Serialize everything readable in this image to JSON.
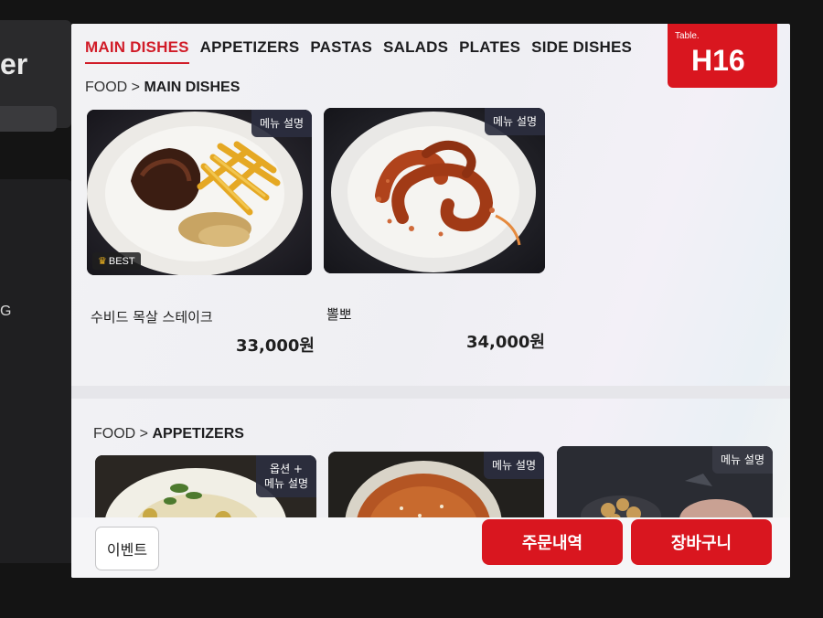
{
  "side": {
    "brand_fragment": "er",
    "nav_fragment": "G"
  },
  "tabs": [
    {
      "label": "MAIN DISHES",
      "active": true
    },
    {
      "label": "APPETIZERS",
      "active": false
    },
    {
      "label": "PASTAS",
      "active": false
    },
    {
      "label": "SALADS",
      "active": false
    },
    {
      "label": "PLATES",
      "active": false
    },
    {
      "label": "SIDE DISHES",
      "active": false
    }
  ],
  "table": {
    "label": "Table.",
    "value": "H16"
  },
  "sections": [
    {
      "crumb_root": "FOOD",
      "crumb_sep": ">",
      "crumb_name": "MAIN DISHES",
      "items": [
        {
          "name": "수비드 목살 스테이크",
          "price": "33,000원",
          "tag": "메뉴 설명",
          "badge": "BEST"
        },
        {
          "name": "뽈뽀",
          "price": "34,000원",
          "tag": "메뉴 설명"
        }
      ]
    },
    {
      "crumb_root": "FOOD",
      "crumb_sep": ">",
      "crumb_name": "APPETIZERS",
      "items": [
        {
          "tag_line1": "옵션 +",
          "tag_line2": "메뉴 설명"
        },
        {
          "tag": "메뉴 설명"
        },
        {
          "tag": "메뉴 설명"
        }
      ]
    }
  ],
  "footer": {
    "event_label": "이벤트",
    "orders_label": "주문내역",
    "cart_label": "장바구니"
  },
  "colors": {
    "accent": "#d9161f",
    "active_tab": "#d11c28",
    "tag_bg": "#2b2e3f"
  }
}
